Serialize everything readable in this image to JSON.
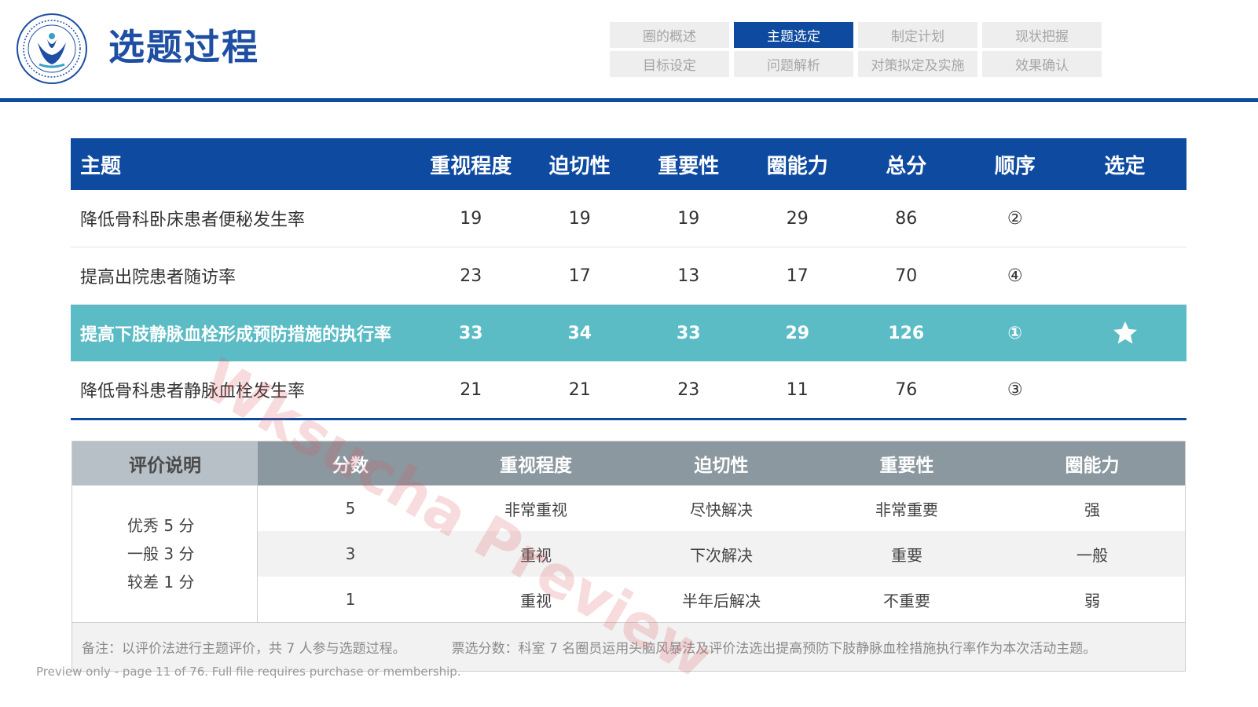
{
  "header": {
    "title": "选题过程",
    "nav": [
      {
        "label": "圈的概述",
        "active": false
      },
      {
        "label": "主题选定",
        "active": true
      },
      {
        "label": "制定计划",
        "active": false
      },
      {
        "label": "现状把握",
        "active": false
      },
      {
        "label": "目标设定",
        "active": false
      },
      {
        "label": "问题解析",
        "active": false
      },
      {
        "label": "对策拟定及实施",
        "active": false
      },
      {
        "label": "效果确认",
        "active": false
      }
    ]
  },
  "main_table": {
    "headers": [
      "主题",
      "重视程度",
      "迫切性",
      "重要性",
      "圈能力",
      "总分",
      "顺序",
      "选定"
    ],
    "rows": [
      {
        "topic": "降低骨科卧床患者便秘发生率",
        "v1": "19",
        "v2": "19",
        "v3": "19",
        "v4": "29",
        "total": "86",
        "order": "②",
        "selected": false
      },
      {
        "topic": "提高出院患者随访率",
        "v1": "23",
        "v2": "17",
        "v3": "13",
        "v4": "17",
        "total": "70",
        "order": "④",
        "selected": false
      },
      {
        "topic": "提高下肢静脉血栓形成预防措施的执行率",
        "v1": "33",
        "v2": "34",
        "v3": "33",
        "v4": "29",
        "total": "126",
        "order": "①",
        "selected": true
      },
      {
        "topic": "降低骨科患者静脉血栓发生率",
        "v1": "21",
        "v2": "21",
        "v3": "23",
        "v4": "11",
        "total": "76",
        "order": "③",
        "selected": false
      }
    ]
  },
  "rating_table": {
    "lead_header": "评价说明",
    "headers": [
      "分数",
      "重视程度",
      "迫切性",
      "重要性",
      "圈能力"
    ],
    "legend": [
      "优秀  5 分",
      "一般  3 分",
      "较差  1 分"
    ],
    "rows": [
      [
        "5",
        "非常重视",
        "尽快解决",
        "非常重要",
        "强"
      ],
      [
        "3",
        "重视",
        "下次解决",
        "重要",
        "一般"
      ],
      [
        "1",
        "重视",
        "半年后解决",
        "不重要",
        "弱"
      ]
    ],
    "note_a": "备注：以评价法进行主题评价，共 7 人参与选题过程。",
    "note_b": "票选分数：科室 7 名圈员运用头脑风暴法及评价法选出提高预防下肢静脉血栓措施执行率作为本次活动主题。"
  },
  "preview_note": "Preview only - page 11 of 76. Full file requires purchase or membership.",
  "watermark": "Wksucha Preview",
  "colors": {
    "primary": "#0d4aa0",
    "highlight": "#5bbcc6",
    "header_gray": "#8b989f"
  }
}
